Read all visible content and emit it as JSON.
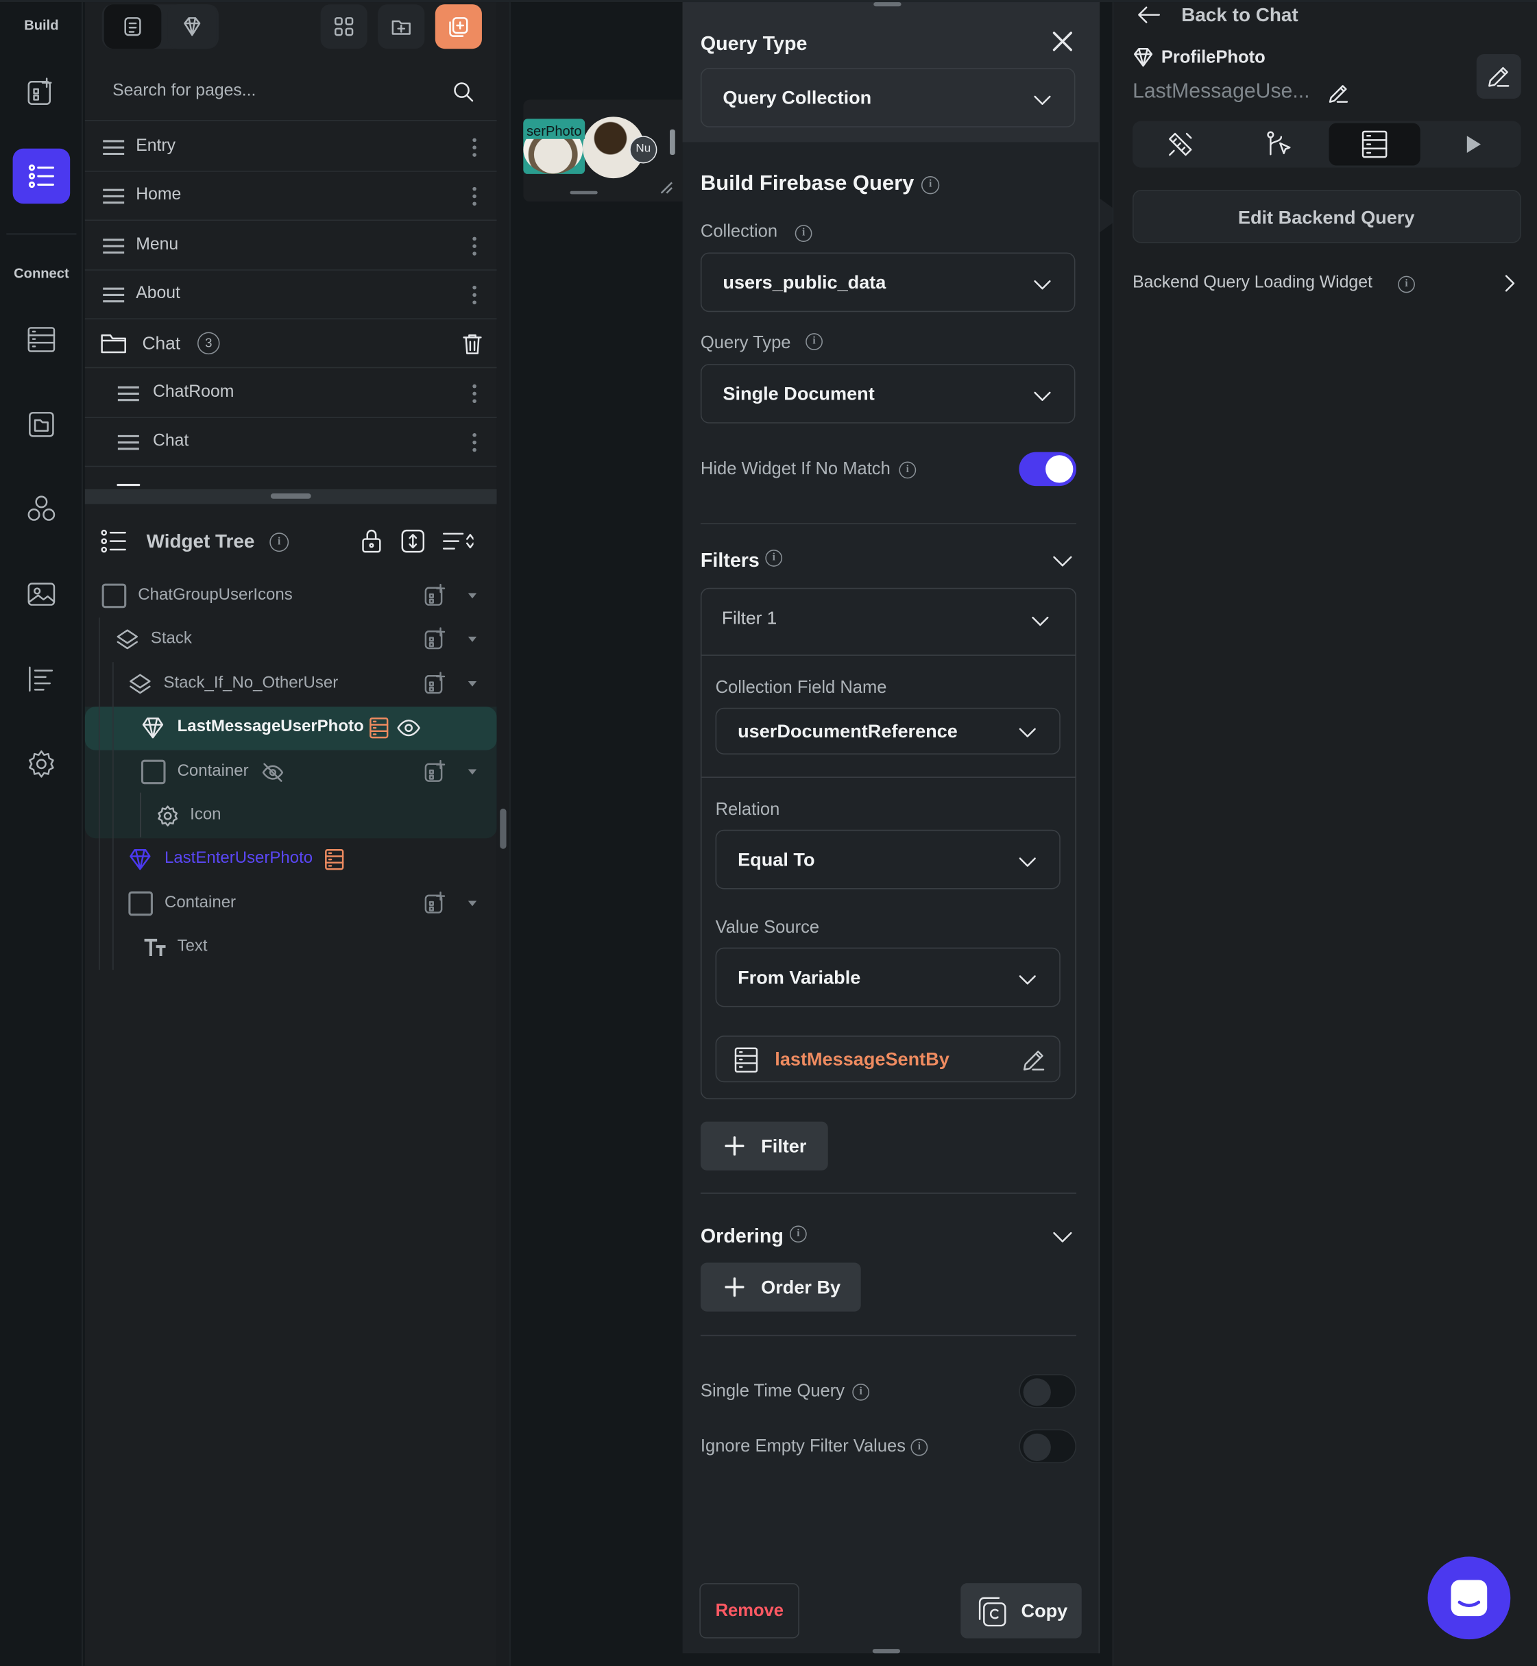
{
  "rail": {
    "build_label": "Build",
    "connect_label": "Connect",
    "icons": [
      "add-page-icon",
      "widget-tree-icon",
      "database-icon",
      "storage-icon",
      "components-icon",
      "media-icon",
      "layout-icon",
      "settings-icon"
    ]
  },
  "left_panel": {
    "search_placeholder": "Search for pages...",
    "pages": [
      {
        "label": "Entry"
      },
      {
        "label": "Home"
      },
      {
        "label": "Menu"
      },
      {
        "label": "About"
      }
    ],
    "folder": {
      "label": "Chat",
      "count": "3"
    },
    "folder_pages": [
      {
        "label": "ChatRoom"
      },
      {
        "label": "Chat"
      }
    ],
    "widget_tree": {
      "title": "Widget Tree",
      "items": [
        {
          "label": "ChatGroupUserIcons",
          "icon": "container-icon"
        },
        {
          "label": "Stack",
          "icon": "stack-icon"
        },
        {
          "label": "Stack_If_No_OtherUser",
          "icon": "stack-icon"
        },
        {
          "label": "LastMessageUserPhoto",
          "icon": "component-icon",
          "selected": true
        },
        {
          "label": "Container",
          "icon": "container-icon"
        },
        {
          "label": "Icon",
          "icon": "gear-icon"
        },
        {
          "label": "LastEnterUserPhoto",
          "icon": "component-icon"
        },
        {
          "label": "Container",
          "icon": "container-icon"
        },
        {
          "label": "Text",
          "icon": "text-icon"
        }
      ]
    }
  },
  "canvas": {
    "preview_tag": "serPhoto",
    "badge": "Nu"
  },
  "query_panel": {
    "title": "Query Type",
    "query_type_value": "Query Collection",
    "build_title": "Build Firebase Query",
    "collection_label": "Collection",
    "collection_value": "users_public_data",
    "query_type_label": "Query Type",
    "query_type2_value": "Single Document",
    "hide_widget_label": "Hide Widget If No Match",
    "hide_widget_on": true,
    "filters_label": "Filters",
    "filter1_label": "Filter 1",
    "field_name_label": "Collection Field Name",
    "field_name_value": "userDocumentReference",
    "relation_label": "Relation",
    "relation_value": "Equal To",
    "value_source_label": "Value Source",
    "value_source_value": "From Variable",
    "variable_value": "lastMessageSentBy",
    "add_filter_label": "Filter",
    "ordering_label": "Ordering",
    "order_by_label": "Order By",
    "single_time_label": "Single Time Query",
    "single_time_on": false,
    "ignore_empty_label": "Ignore Empty Filter Values",
    "ignore_empty_on": false,
    "remove_label": "Remove",
    "copy_label": "Copy"
  },
  "right_panel": {
    "back_label": "Back to Chat",
    "component_name": "ProfilePhoto",
    "widget_name": "LastMessageUse...",
    "tabs": [
      "properties-icon",
      "actions-icon",
      "backend-query-icon",
      "play-icon"
    ],
    "edit_query_label": "Edit Backend Query",
    "loading_widget_label": "Backend Query Loading Widget"
  },
  "colors": {
    "accent": "#4b39ef",
    "orange": "#ee8b60",
    "remove_red": "#ff5963",
    "selected_row": "#1f3f3d"
  }
}
